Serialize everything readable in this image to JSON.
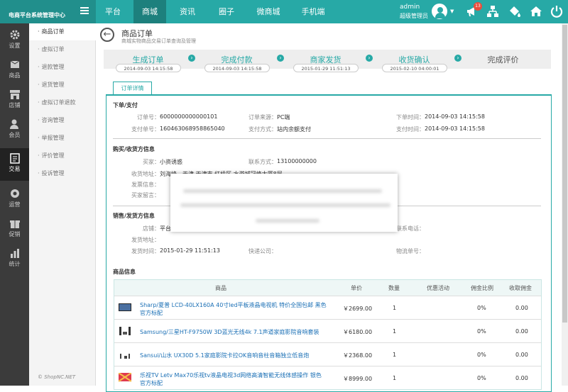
{
  "brand": "电商平台系统管理中心",
  "nav": [
    "平台",
    "商城",
    "资讯",
    "圈子",
    "微商城",
    "手机端"
  ],
  "admin": {
    "name": "admin",
    "role": "超级管理员",
    "notifications": "13"
  },
  "sidebar": [
    "设置",
    "商品",
    "店铺",
    "会员",
    "交易",
    "运营",
    "促销",
    "统计"
  ],
  "subnav": [
    "商品订单",
    "虚拟订单",
    "退款管理",
    "退货管理",
    "虚拟订单退款",
    "咨询管理",
    "举报管理",
    "评价管理",
    "投诉管理"
  ],
  "copyright": "© ShopNC.NET",
  "page": {
    "title": "商品订单",
    "subtitle": "商城实物商品交易订单查询及管理"
  },
  "steps": [
    {
      "label": "生成订单",
      "time": "2014-09-03 14:15:58"
    },
    {
      "label": "完成付款",
      "time": "2014-09-03 14:15:58"
    },
    {
      "label": "商家发货",
      "time": "2015-01-29 11:51:13"
    },
    {
      "label": "收货确认",
      "time": "2015-02-10 04:00:01"
    },
    {
      "label": "完成评价",
      "time": ""
    }
  ],
  "tab": "订单详情",
  "order": {
    "section": "下单/支付",
    "order_no_label": "订单号：",
    "order_no": "6000000000000101",
    "source_label": "订单来源：",
    "source": "PC端",
    "time_label": "下单时间：",
    "time": "2014-09-03 14:15:58",
    "pay_no_label": "支付单号：",
    "pay_no": "160463068958865040",
    "pay_method_label": "支付方式：",
    "pay_method": "站内余额支付",
    "pay_time_label": "支付时间：",
    "pay_time": "2014-09-03 14:15:58"
  },
  "buyer": {
    "section": "购买/收货方信息",
    "buyer_label": "买家：",
    "buyer": "小资诱惑",
    "contact_label": "联系方式：",
    "contact": "13100000000",
    "address_label": "收货地址：",
    "address": "刘海峰，天津 天津市 红桥区 水游城冠峰大厦8层",
    "invoice_label": "发票信息：",
    "message_label": "买家留言："
  },
  "seller": {
    "section": "销售/发货方信息",
    "shop_label": "店铺：",
    "shop": "平台自营",
    "phone_label": "联系电话：",
    "ship_addr_label": "发货地址：",
    "ship_time_label": "发货时间：",
    "ship_time": "2015-01-29 11:51:13",
    "express_label": "快递公司：",
    "tracking_label": "物流单号："
  },
  "goods": {
    "section": "商品信息",
    "headers": [
      "商品",
      "单价",
      "数量",
      "优惠活动",
      "佣金比例",
      "收取佣金"
    ],
    "rows": [
      {
        "name": "Sharp/夏普 LCD-40LX160A 40寸led平板液晶电视机 特价全国包邮 黑色 官方标配",
        "price": "￥2699.00",
        "qty": "1",
        "promo": "",
        "rate": "0%",
        "commission": "0.00"
      },
      {
        "name": "Samsung/三星HT-F9750W 3D蓝光无线4k 7.1声道家庭影院音响套装",
        "price": "￥6180.00",
        "qty": "1",
        "promo": "",
        "rate": "0%",
        "commission": "0.00"
      },
      {
        "name": "Sansui/山水 UX30D 5.1家庭影院卡拉OK音响音柱音箱独立低音炮",
        "price": "￥2368.00",
        "qty": "1",
        "promo": "",
        "rate": "0%",
        "commission": "0.00"
      },
      {
        "name": "乐视TV Letv Max70乐视tv液晶电视3d网络高清智能无线体感操作 银色 官方标配",
        "price": "￥8999.00",
        "qty": "1",
        "promo": "",
        "rate": "0%",
        "commission": "0.00"
      }
    ]
  }
}
